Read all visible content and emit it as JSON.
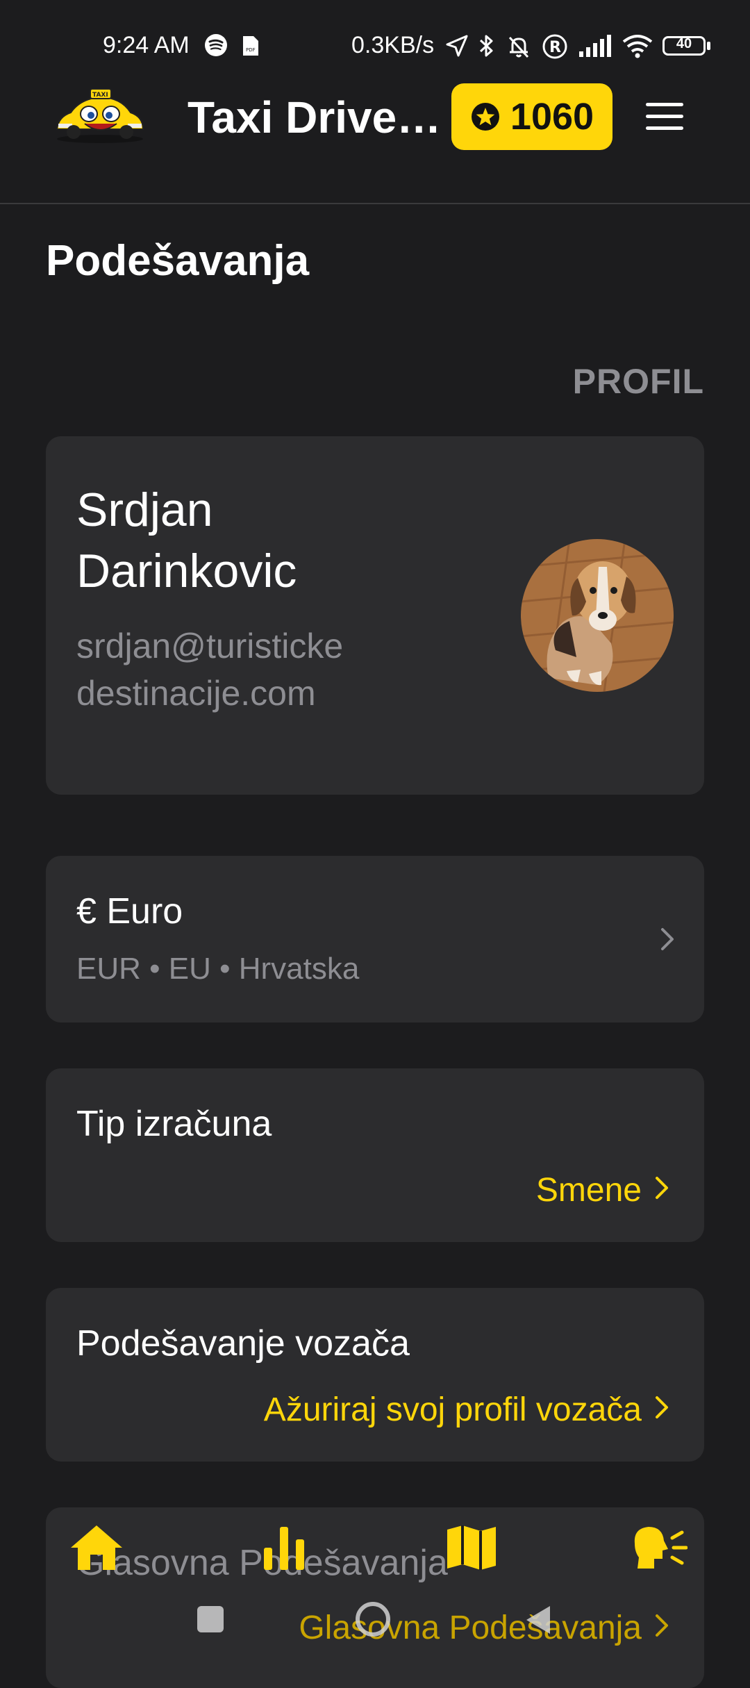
{
  "status_bar": {
    "time": "9:24 AM",
    "network_speed": "0.3KB/s",
    "battery": "40"
  },
  "header": {
    "app_title": "Taxi Driver...",
    "points": "1060",
    "accent_color": "#ffd60a"
  },
  "page": {
    "title": "Podešavanja",
    "section_label": "PROFIL"
  },
  "profile": {
    "name": "Srdjan Darinkovic",
    "email": "srdjan@turistickedestinacije.com"
  },
  "currency": {
    "title": "€ Euro",
    "subtitle": "EUR • EU • Hrvatska"
  },
  "calculation": {
    "title": "Tip izračuna",
    "value": "Smene"
  },
  "driver_settings": {
    "title": "Podešavanje vozača",
    "link": "Ažuriraj svoj profil vozača"
  },
  "voice_settings": {
    "title": "Glasovna Podešavanja",
    "link": "Glasovna Podešavanja"
  },
  "bottom_nav": {
    "items": [
      "home-icon",
      "stats-icon",
      "map-icon",
      "voice-icon"
    ]
  },
  "system_nav": {
    "items": [
      "recents-button",
      "home-button",
      "back-button"
    ]
  }
}
